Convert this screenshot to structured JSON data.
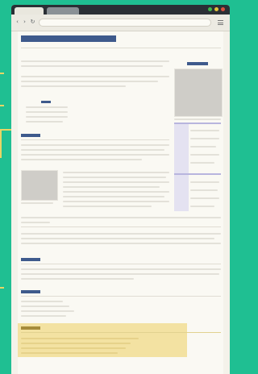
{
  "browser": {
    "tabs": [
      {
        "label": ""
      },
      {
        "label": ""
      }
    ],
    "url": "",
    "colors": {
      "background": "#1fbf92",
      "accent_heading": "#3e5a8c",
      "highlight": "#f3e2a2",
      "sidebar_tint": "#e4e2f1",
      "connector": "#e8d565"
    },
    "window_buttons": [
      "#3fb54b",
      "#e3c23c",
      "#d9503f"
    ]
  },
  "icons": [
    "back-arrow-icon",
    "forward-arrow-icon",
    "reload-icon",
    "menu-icon"
  ]
}
